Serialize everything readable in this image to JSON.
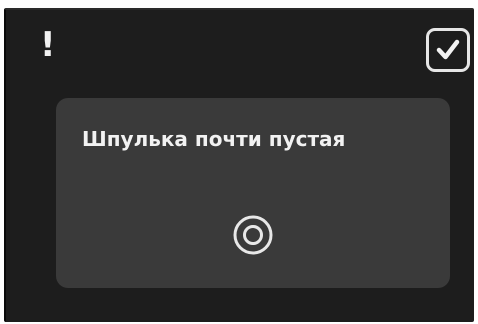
{
  "dialog": {
    "alert_symbol": "!",
    "alert_icon": "exclamation-icon",
    "confirm_icon": "checkmark-icon",
    "message": "Шпулька почти пустая",
    "status_icon": "bobbin-icon"
  },
  "colors": {
    "dialog_background": "#1d1d1d",
    "panel_background": "#3a3a3a",
    "foreground": "#f2f2f2"
  }
}
